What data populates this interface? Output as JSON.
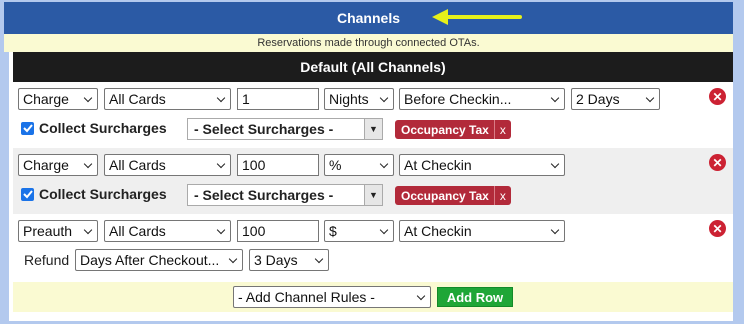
{
  "header": {
    "title": "Channels",
    "note": "Reservations made through connected OTAs.",
    "section": "Default (All Channels)"
  },
  "colors": {
    "header_bg": "#2b5aa5",
    "tag_bg": "#b22a3a",
    "add_bg": "#1fa637",
    "arrow": "#e6f019"
  },
  "rules": [
    {
      "type": "Charge",
      "cards": "All Cards",
      "amount": "1",
      "unit": "Nights",
      "timing": "Before Checkin...",
      "days": "2 Days",
      "collect_label": "Collect Surcharges",
      "surcharge_select": "- Select Surcharges -",
      "tag": "Occupancy Tax",
      "tag_x": "x"
    },
    {
      "type": "Charge",
      "cards": "All Cards",
      "amount": "100",
      "unit": "%",
      "timing": "At Checkin",
      "collect_label": "Collect Surcharges",
      "surcharge_select": "- Select Surcharges -",
      "tag": "Occupancy Tax",
      "tag_x": "x"
    },
    {
      "type": "Preauth",
      "cards": "All Cards",
      "amount": "100",
      "unit": "$",
      "timing": "At Checkin",
      "refund_label": "Refund",
      "refund_timing": "Days After Checkout...",
      "refund_days": "3 Days"
    }
  ],
  "footer": {
    "add_rules_select": "- Add Channel Rules -",
    "add_row": "Add Row"
  },
  "icons": {
    "delete": "x-circle-icon",
    "arrow": "arrow-left-icon",
    "check": "checkbox-checked-icon"
  }
}
